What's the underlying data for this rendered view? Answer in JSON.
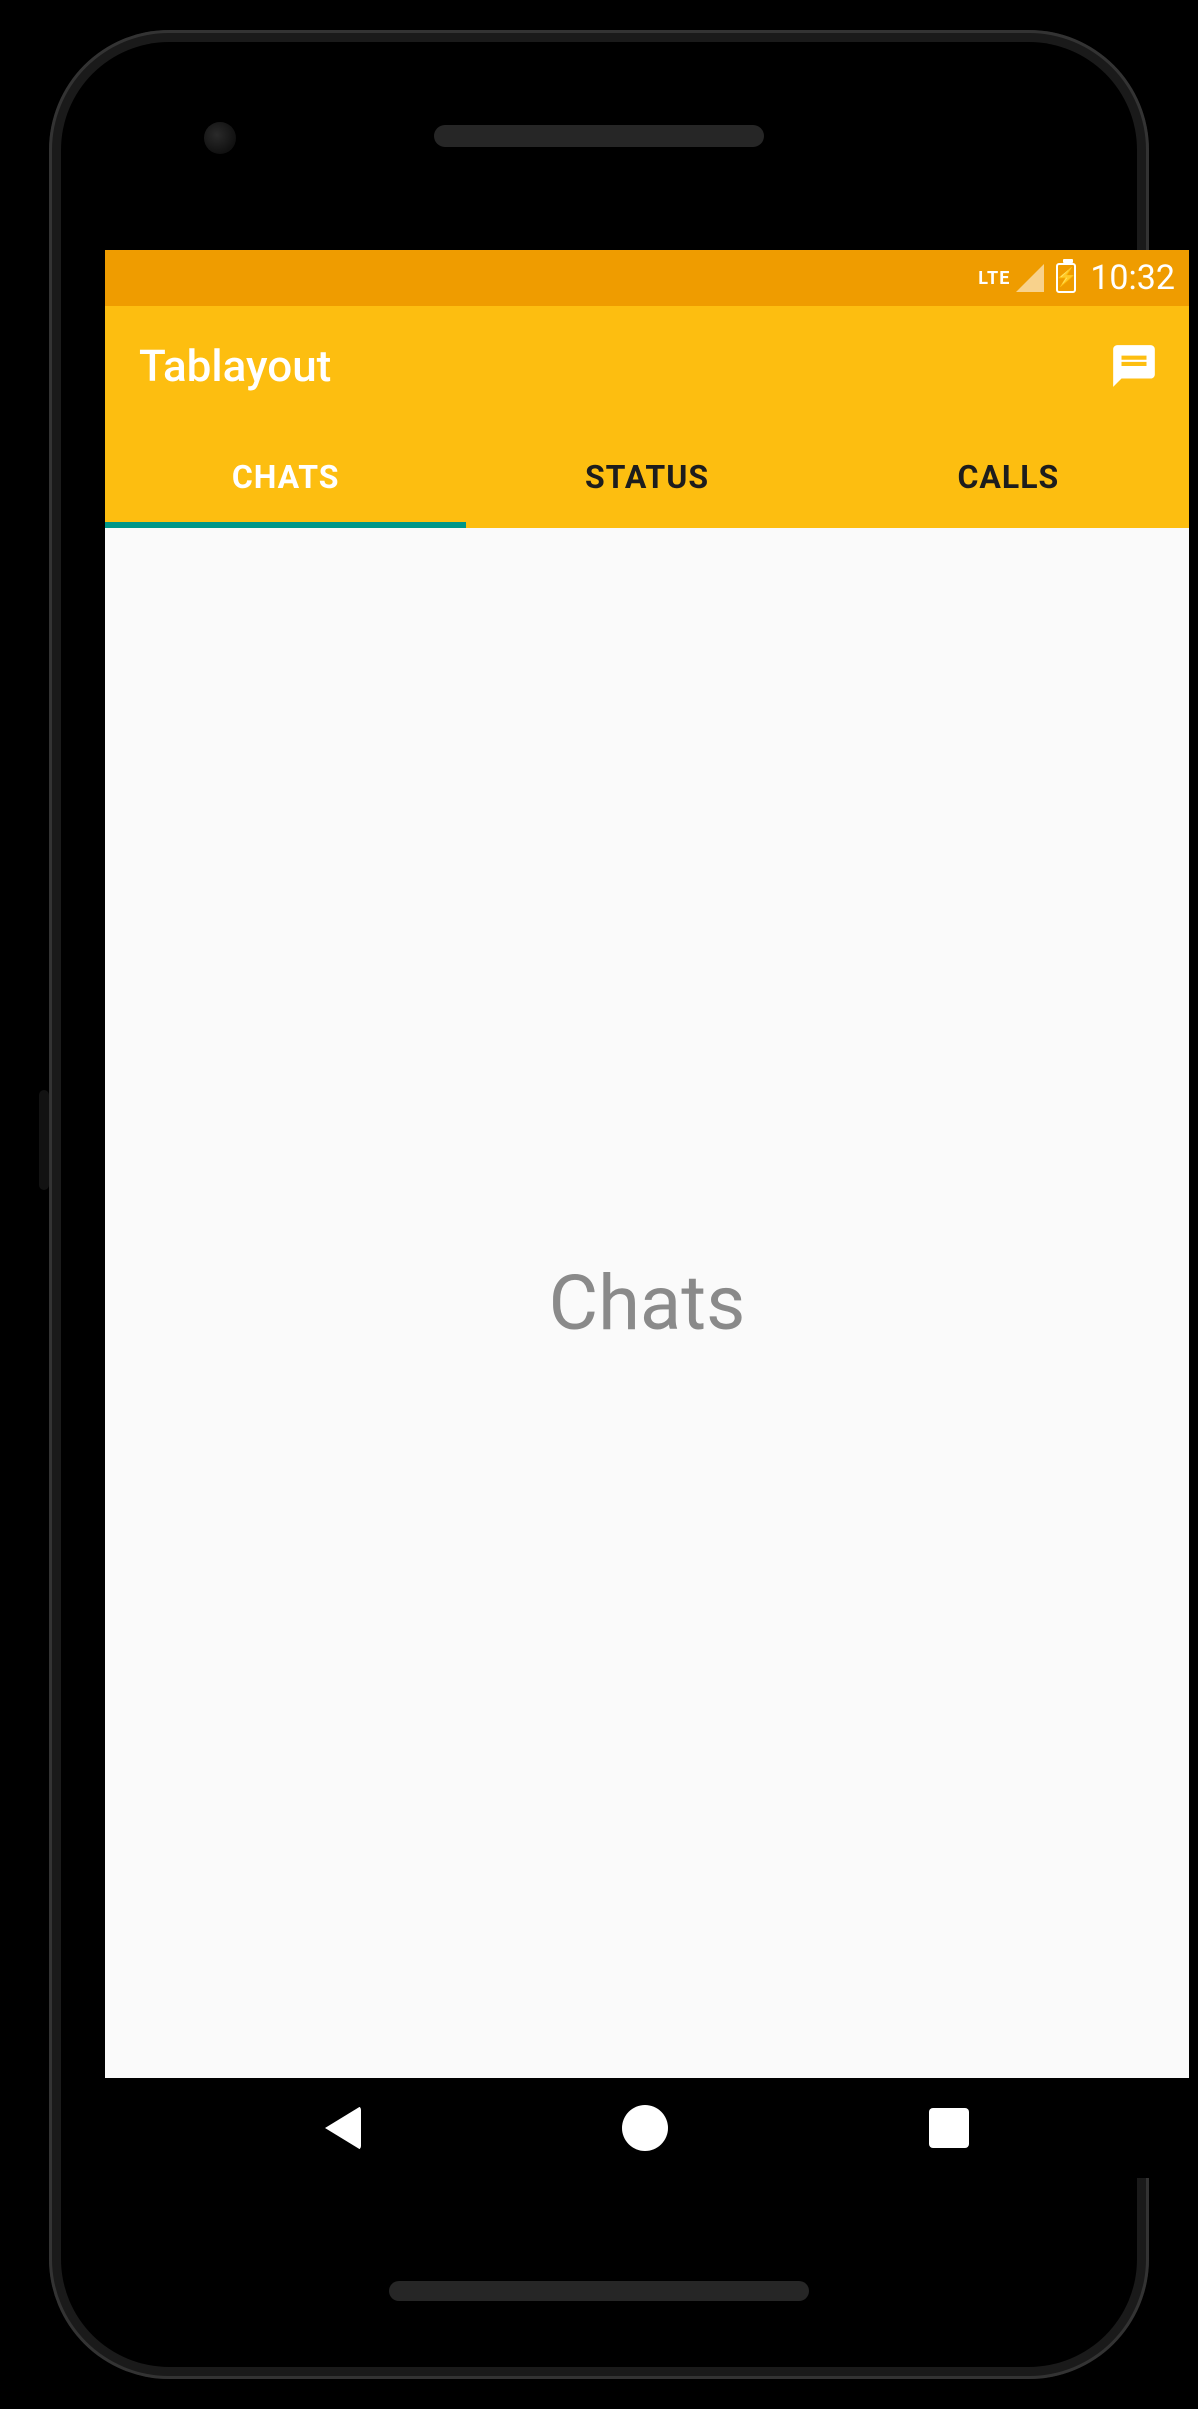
{
  "status_bar": {
    "network_label": "LTE",
    "time": "10:32"
  },
  "app_bar": {
    "title": "Tablayout"
  },
  "tabs": {
    "items": [
      {
        "label": "CHATS",
        "active": true
      },
      {
        "label": "STATUS",
        "active": false
      },
      {
        "label": "CALLS",
        "active": false
      }
    ]
  },
  "content": {
    "body_text": "Chats"
  },
  "colors": {
    "status_bar_bg": "#ef9c00",
    "app_bar_bg": "#fdbe10",
    "tab_indicator": "#009688",
    "content_bg": "#fafafa"
  }
}
